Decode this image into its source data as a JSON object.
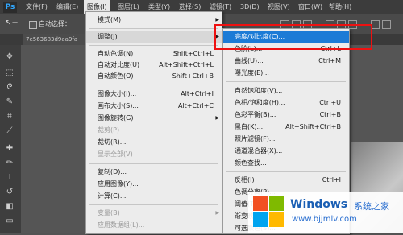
{
  "menubar": {
    "logo": "Ps",
    "items": [
      "文件(F)",
      "编辑(E)",
      "图像(I)",
      "图层(L)",
      "类型(Y)",
      "选择(S)",
      "滤镜(T)",
      "3D(D)",
      "视图(V)",
      "窗口(W)",
      "帮助(H)"
    ]
  },
  "options": {
    "tool_icon": "↖+",
    "auto_select_label": "自动选择："
  },
  "document": {
    "tab_label": "7e563683d9aa9fa"
  },
  "image_menu": {
    "items": [
      {
        "label": "模式(M)",
        "shortcut": "",
        "submenu": true,
        "disabled": false
      },
      {
        "label": "调整(J)",
        "shortcut": "",
        "submenu": true,
        "disabled": false,
        "highlighted": true
      },
      {
        "label": "自动色调(N)",
        "shortcut": "Shift+Ctrl+L",
        "submenu": false,
        "disabled": false
      },
      {
        "label": "自动对比度(U)",
        "shortcut": "Alt+Shift+Ctrl+L",
        "submenu": false,
        "disabled": false
      },
      {
        "label": "自动颜色(O)",
        "shortcut": "Shift+Ctrl+B",
        "submenu": false,
        "disabled": false
      },
      {
        "label": "图像大小(I)...",
        "shortcut": "Alt+Ctrl+I",
        "submenu": false,
        "disabled": false
      },
      {
        "label": "画布大小(S)...",
        "shortcut": "Alt+Ctrl+C",
        "submenu": false,
        "disabled": false
      },
      {
        "label": "图像旋转(G)",
        "shortcut": "",
        "submenu": true,
        "disabled": false
      },
      {
        "label": "裁剪(P)",
        "shortcut": "",
        "submenu": false,
        "disabled": true
      },
      {
        "label": "裁切(R)...",
        "shortcut": "",
        "submenu": false,
        "disabled": false
      },
      {
        "label": "显示全部(V)",
        "shortcut": "",
        "submenu": false,
        "disabled": true
      },
      {
        "label": "复制(D)...",
        "shortcut": "",
        "submenu": false,
        "disabled": false
      },
      {
        "label": "应用图像(Y)...",
        "shortcut": "",
        "submenu": false,
        "disabled": false
      },
      {
        "label": "计算(C)...",
        "shortcut": "",
        "submenu": false,
        "disabled": false
      },
      {
        "label": "变量(B)",
        "shortcut": "",
        "submenu": true,
        "disabled": true
      },
      {
        "label": "应用数据组(L)...",
        "shortcut": "",
        "submenu": false,
        "disabled": true
      }
    ]
  },
  "adjust_menu": {
    "items": [
      {
        "label": "亮度/对比度(C)...",
        "shortcut": "",
        "highlighted": true
      },
      {
        "label": "色阶(L)...",
        "shortcut": "Ctrl+L"
      },
      {
        "label": "曲线(U)...",
        "shortcut": "Ctrl+M"
      },
      {
        "label": "曝光度(E)...",
        "shortcut": ""
      },
      {
        "label": "自然饱和度(V)...",
        "shortcut": ""
      },
      {
        "label": "色相/饱和度(H)...",
        "shortcut": "Ctrl+U"
      },
      {
        "label": "色彩平衡(B)...",
        "shortcut": "Ctrl+B"
      },
      {
        "label": "黑白(K)...",
        "shortcut": "Alt+Shift+Ctrl+B"
      },
      {
        "label": "照片滤镜(F)...",
        "shortcut": ""
      },
      {
        "label": "通道混合器(X)...",
        "shortcut": ""
      },
      {
        "label": "颜色查找...",
        "shortcut": ""
      },
      {
        "label": "反相(I)",
        "shortcut": "Ctrl+I"
      },
      {
        "label": "色调分离(P)...",
        "shortcut": ""
      },
      {
        "label": "阈值(T)...",
        "shortcut": ""
      },
      {
        "label": "渐变映射(G)...",
        "shortcut": ""
      },
      {
        "label": "可选颜色(S)...",
        "shortcut": ""
      }
    ]
  },
  "watermark": {
    "title": "Windows",
    "subtitle": "系统之家",
    "url": "www.bjjmlv.com"
  },
  "colors": {
    "highlight": "#1c7bd6",
    "annotation_box": "#e11111",
    "menu_bg": "#ececec"
  }
}
